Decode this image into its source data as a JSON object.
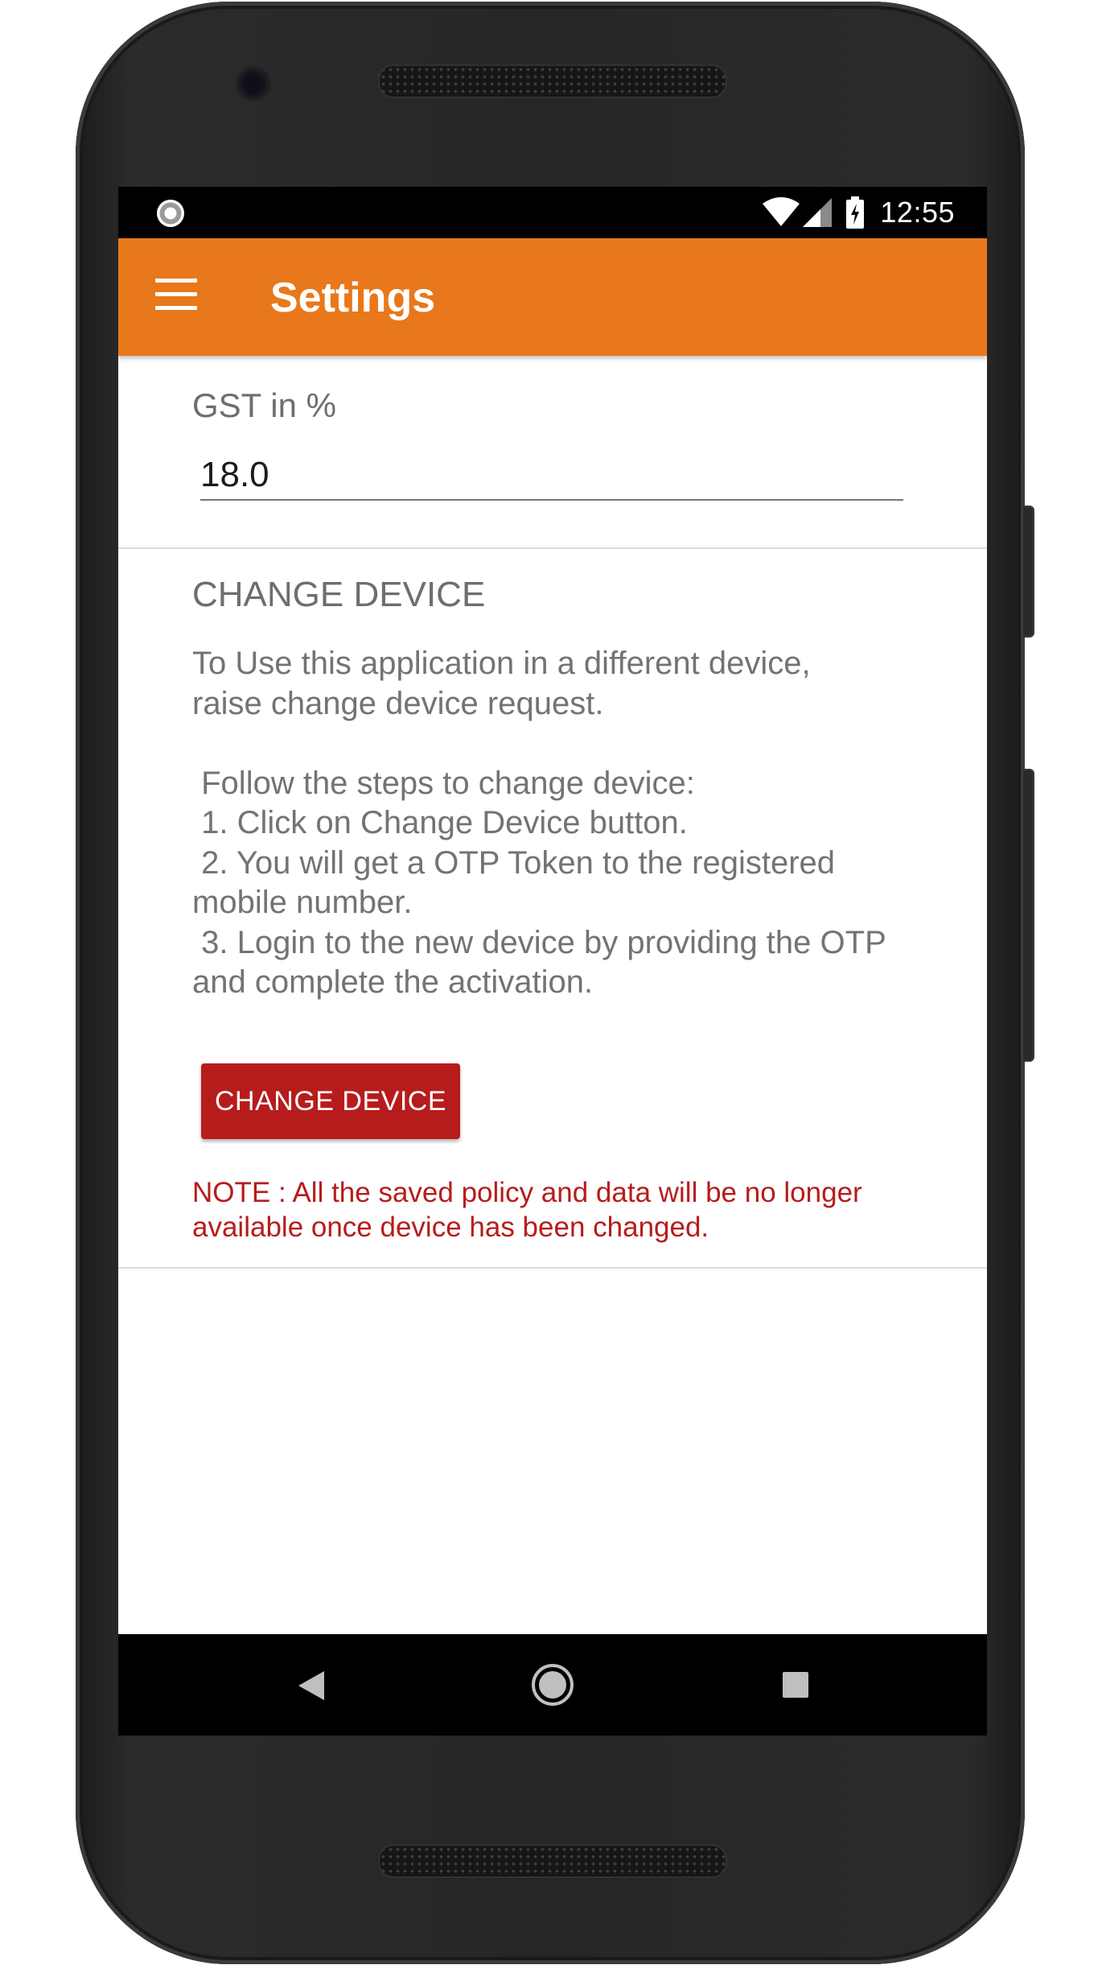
{
  "status_bar": {
    "time": "12:55",
    "icons": [
      "sync-icon",
      "wifi-icon",
      "signal-icon",
      "battery-charging-icon"
    ]
  },
  "app_bar": {
    "title": "Settings",
    "menu_icon": "hamburger-menu-icon",
    "color": "#e8781b"
  },
  "gst": {
    "label": "GST in %",
    "value": "18.0"
  },
  "change_device": {
    "heading": "CHANGE DEVICE",
    "description": "To Use this application in a different device,\nraise change device request.\n\n Follow the steps to change device:\n 1. Click on Change Device button.\n 2. You will get a OTP Token to the registered\nmobile number.\n 3. Login to the new device by providing the OTP\nand complete the activation.",
    "button_label": "CHANGE DEVICE",
    "button_color": "#b71c1c",
    "note": "NOTE : All the saved policy and data will be no longer available once device has been changed."
  },
  "nav_bar": {
    "icons": [
      "back-icon",
      "home-icon",
      "recents-icon"
    ]
  }
}
